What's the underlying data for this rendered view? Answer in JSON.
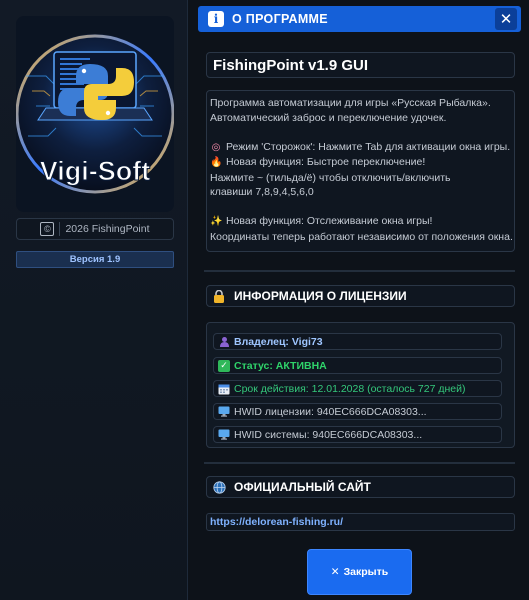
{
  "sidebar": {
    "logo_text": "Vigi-Soft",
    "copyright_icon": "©",
    "copyright_text": "2026 FishingPoint",
    "version_label": "Версия 1.9"
  },
  "titlebar": {
    "info_icon": "i",
    "title": "О ПРОГРАММЕ",
    "close_icon": "✕"
  },
  "app": {
    "name": "FishingPoint v1.9 GUI"
  },
  "description": {
    "line1": "Программа автоматизации для игры «Русская Рыбалка».",
    "line2": "Автоматический заброс и переключение удочек.",
    "line3": "Режим 'Сторожок': Нажмите Tab для активации окна игры.",
    "line4": "Новая функция: Быстрое переключение!",
    "line5": "Нажмите ~ (тильда/ё) чтобы отключить/включить",
    "line6": "клавиши 7,8,9,4,5,6,0",
    "line7": "Новая функция: Отслеживание окна игры!",
    "line8": "Координаты теперь работают независимо от положения окна.",
    "icon_target": "◎",
    "icon_fire": "🔥",
    "icon_sparkle": "✨"
  },
  "license": {
    "heading": "ИНФОРМАЦИЯ О ЛИЦЕНЗИИ",
    "owner": "Владелец: Vigi73",
    "status": "Статус: АКТИВНА",
    "expiry": "Срок действия: 12.01.2028 (осталось 727 дней)",
    "hwid_license": "HWID лицензии: 940EC666DCA08303...",
    "hwid_system": "HWID системы: 940EC666DCA08303...",
    "colors": {
      "owner": "#9fc6ff",
      "status": "#2fd36a",
      "expiry": "#34c77b",
      "hwid": "#c5cbd4"
    }
  },
  "site": {
    "heading": "ОФИЦИАЛЬНЫЙ САЙТ",
    "url": "https://delorean-fishing.ru/"
  },
  "actions": {
    "close_icon": "✕",
    "close_label": "Закрыть"
  },
  "theme": {
    "accent": "#1560d8",
    "background": "#0d1219"
  }
}
